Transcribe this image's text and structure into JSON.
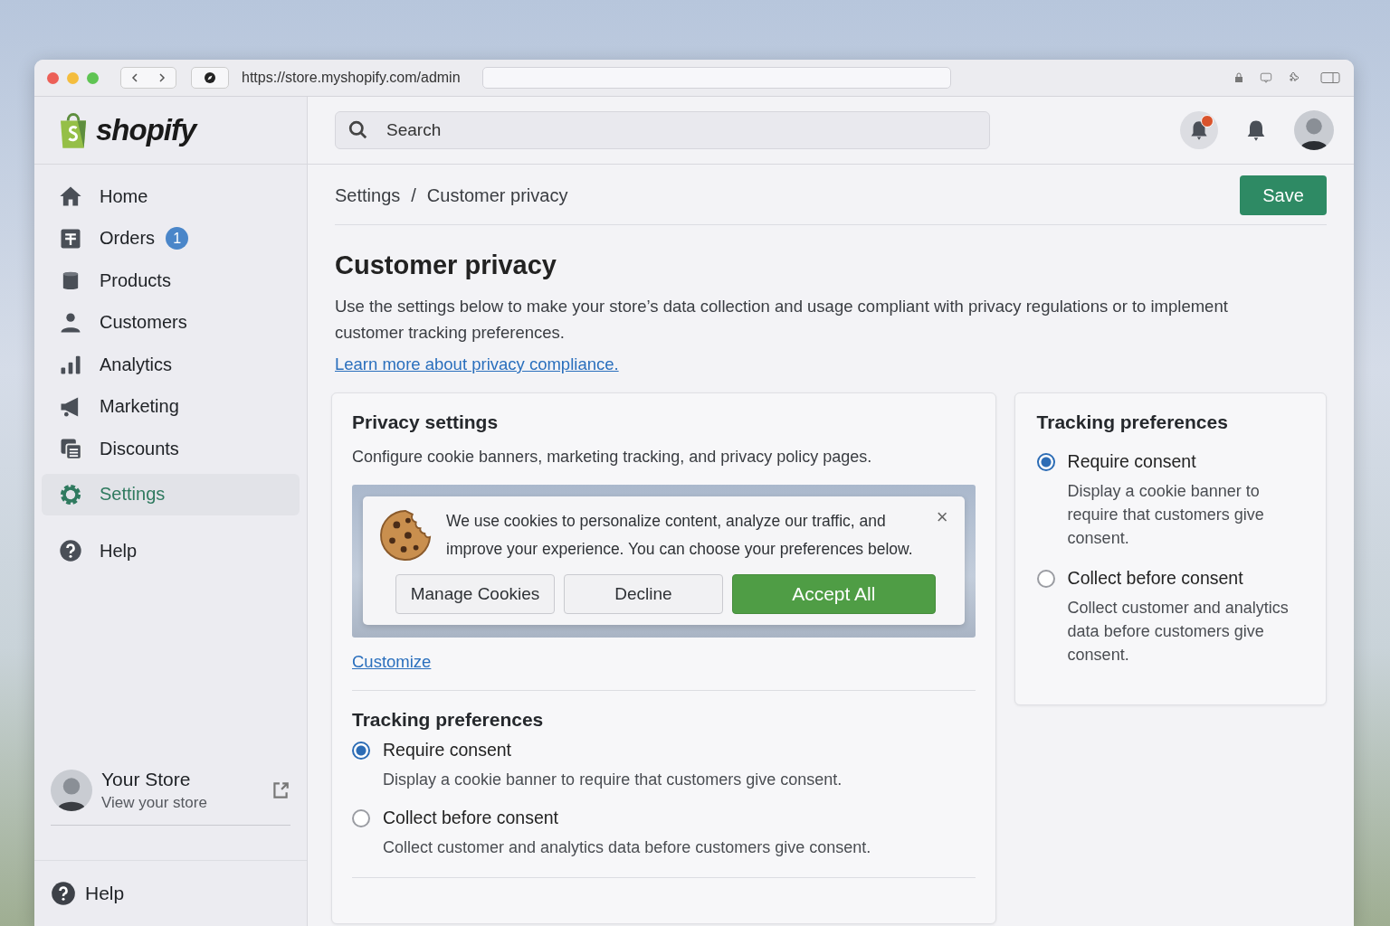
{
  "browser": {
    "url": "https://store.myshopify.com/admin"
  },
  "header": {
    "logo": "shopify",
    "search": {
      "placeholder": "Search"
    },
    "notification_unread": true
  },
  "sidebar": {
    "items": [
      {
        "label": "Home",
        "selected": false
      },
      {
        "label": "Orders",
        "selected": false,
        "badge": "1"
      },
      {
        "label": "Products",
        "selected": false
      },
      {
        "label": "Customers",
        "selected": false
      },
      {
        "label": "Analytics",
        "selected": false
      },
      {
        "label": "Marketing",
        "selected": false
      },
      {
        "label": "Discounts",
        "selected": false
      },
      {
        "label": "Settings",
        "selected": true
      },
      {
        "label": "Help",
        "selected": false
      }
    ],
    "store": {
      "name": "Your Store",
      "subtitle": "View your store"
    },
    "footer_help": "Help"
  },
  "breadcrumb": {
    "items": [
      "Settings",
      "Customer privacy"
    ],
    "separator": "/"
  },
  "save_button": "Save",
  "page": {
    "title": "Customer privacy",
    "description": "Use the settings below to make your store’s data collection and usage compliant with privacy regulations or to implement customer tracking preferences.",
    "link": "Learn more about privacy compliance."
  },
  "privacy_card": {
    "title": "Privacy settings",
    "description": "Configure cookie banners, marketing tracking, and privacy policy pages.",
    "cookie_banner": {
      "message": "We use cookies to personalize content, analyze our traffic, and improve your experience. You can choose your preferences below.",
      "close": "×",
      "buttons": [
        {
          "label": "Manage Cookies",
          "kind": "secondary"
        },
        {
          "label": "Decline",
          "kind": "secondary"
        },
        {
          "label": "Accept All",
          "kind": "primary"
        }
      ]
    },
    "customize_link": "Customize",
    "tracking": {
      "title": "Tracking preferences",
      "options": [
        {
          "label": "Require consent",
          "description": "Display a cookie banner to require that customers give consent.",
          "selected": true
        },
        {
          "label": "Collect before consent",
          "description": "Collect customer and analytics data before customers give consent.",
          "selected": false
        }
      ]
    }
  },
  "side_card": {
    "title": "Tracking preferences",
    "options": [
      {
        "label": "Require consent",
        "description": "Display a cookie banner to require that customers give consent.",
        "selected": true
      },
      {
        "label": "Collect before consent",
        "description": "Collect customer and analytics data before customers give consent.",
        "selected": false
      }
    ]
  }
}
